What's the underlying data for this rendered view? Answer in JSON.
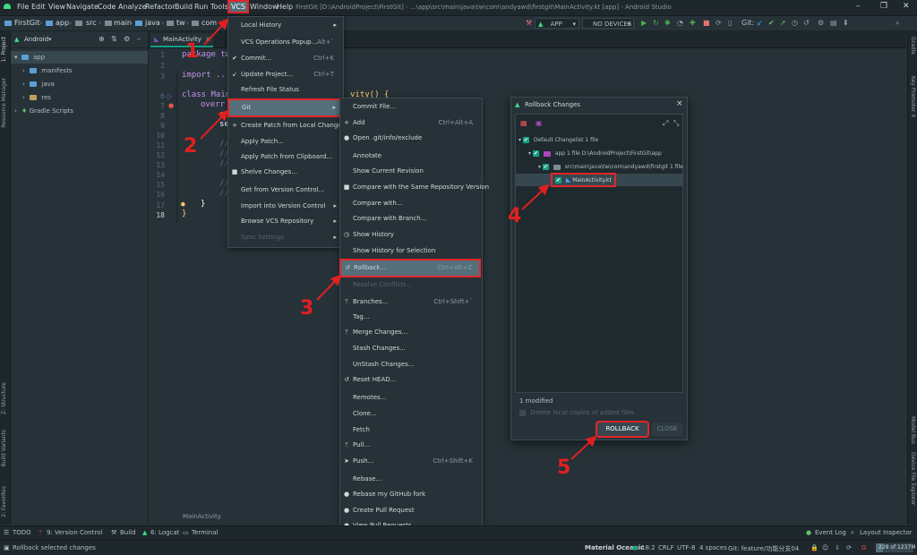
{
  "window_title": "FirstGit [D:\\AndroidProject\\FirstGit] - ...\\app\\src\\main\\java\\tw\\com\\andyawd\\firstgit\\MainActivity.kt [app] - Android Studio",
  "menubar": [
    "File",
    "Edit",
    "View",
    "Navigate",
    "Code",
    "Analyze",
    "Refactor",
    "Build",
    "Run",
    "Tools",
    "VCS",
    "Window",
    "Help"
  ],
  "breadcrumbs": [
    "FirstGit",
    "app",
    "src",
    "main",
    "java",
    "tw",
    "com"
  ],
  "run_config": "APP",
  "device": "NO DEVICES",
  "git_label": "Git:",
  "project_panel": {
    "view": "Android",
    "tree": [
      {
        "label": "app",
        "level": 0,
        "selected": true
      },
      {
        "label": "manifests",
        "level": 1
      },
      {
        "label": "java",
        "level": 1
      },
      {
        "label": "res",
        "level": 1
      },
      {
        "label": "Gradle Scripts",
        "level": 0
      }
    ]
  },
  "editor": {
    "tab": "MainActivity",
    "tab_close": "×",
    "line_numbers": [
      "1",
      "2",
      "3",
      "",
      "6",
      "7",
      "8",
      "9",
      "10",
      "11",
      "12",
      "13",
      "14",
      "15",
      "16",
      "17",
      "18"
    ],
    "code": {
      "l1": "package tw",
      "l3": "import ...",
      "l6": "class Main",
      "l6b": "vity() {",
      "l7": "overr",
      "l8": "s",
      "l9": "se",
      "l11": "//",
      "l12": "//",
      "l13": "//",
      "l15": "//",
      "l16": "//",
      "l17": "}",
      "l18": "}"
    },
    "breadcrumb_bottom": "MainActivity"
  },
  "vcs_menu": [
    {
      "label": "Local History",
      "arrow": true
    },
    {
      "label": "VCS Operations Popup...",
      "shortcut": "Alt+`"
    },
    {
      "label": "Commit...",
      "shortcut": "Ctrl+K",
      "icon": "✔"
    },
    {
      "label": "Update Project...",
      "shortcut": "Ctrl+T",
      "icon": "↙"
    },
    {
      "label": "Refresh File Status"
    },
    {
      "label": "Git",
      "arrow": true,
      "selected": true
    },
    {
      "label": "Create Patch from Local Changes...",
      "icon": "+"
    },
    {
      "label": "Apply Patch..."
    },
    {
      "label": "Apply Patch from Clipboard..."
    },
    {
      "label": "Shelve Changes...",
      "icon": "■"
    },
    {
      "label": "Get from Version Control..."
    },
    {
      "label": "Import into Version Control",
      "arrow": true
    },
    {
      "label": "Browse VCS Repository",
      "arrow": true
    },
    {
      "label": "Sync Settings",
      "arrow": true,
      "disabled": true
    }
  ],
  "git_menu": [
    {
      "label": "Commit File..."
    },
    {
      "label": "Add",
      "shortcut": "Ctrl+Alt+A",
      "icon": "+"
    },
    {
      "label": "Open .git/info/exclude",
      "icon": "●"
    },
    {
      "label": "Annotate"
    },
    {
      "label": "Show Current Revision"
    },
    {
      "label": "Compare with the Same Repository Version",
      "icon": "■"
    },
    {
      "label": "Compare with..."
    },
    {
      "label": "Compare with Branch..."
    },
    {
      "label": "Show History",
      "icon": "◷"
    },
    {
      "label": "Show History for Selection"
    },
    {
      "label": "Rollback...",
      "shortcut": "Ctrl+Alt+Z",
      "icon": "↺",
      "selected": true
    },
    {
      "label": "Resolve Conflicts...",
      "disabled": true
    },
    {
      "label": "Branches...",
      "shortcut": "Ctrl+Shift+`",
      "icon": "ᛘ"
    },
    {
      "label": "Tag..."
    },
    {
      "label": "Merge Changes...",
      "icon": "ᛘ"
    },
    {
      "label": "Stash Changes..."
    },
    {
      "label": "UnStash Changes..."
    },
    {
      "label": "Reset HEAD...",
      "icon": "↺"
    },
    {
      "label": "Remotes..."
    },
    {
      "label": "Clone..."
    },
    {
      "label": "Fetch"
    },
    {
      "label": "Pull...",
      "icon": "ᛘ"
    },
    {
      "label": "Push...",
      "shortcut": "Ctrl+Shift+K",
      "icon": "➤"
    },
    {
      "label": "Rebase..."
    },
    {
      "label": "Rebase my GitHub fork",
      "icon": "●"
    },
    {
      "label": "Create Pull Request",
      "icon": "●"
    },
    {
      "label": "View Pull Requests",
      "icon": "●"
    }
  ],
  "rollback_dialog": {
    "title": "Rollback Changes",
    "close": "×",
    "tree": [
      {
        "label": "Default Changelist 1 file",
        "level": 0
      },
      {
        "label": "app 1 file D:\\AndroidProject\\FirstGit\\app",
        "level": 1
      },
      {
        "label": "src\\main\\java\\tw\\com\\andyawd\\firstgit 1 file",
        "level": 2
      },
      {
        "label": "MainActivity.kt",
        "level": 3
      }
    ],
    "summary": "1 modified",
    "delete_checkbox": "Delete local copies of added files",
    "rollback_button": "ROLLBACK",
    "close_button": "CLOSE"
  },
  "annotations": [
    "1",
    "2",
    "3",
    "4",
    "5"
  ],
  "left_tabs": [
    "1: Project",
    "Resource Manager",
    "Z: Structure",
    "Build Variants",
    "2: Favorites"
  ],
  "right_tabs": [
    "Gradle",
    "Key Promoter X",
    "Model Bus",
    "Device File Explorer"
  ],
  "tool_windows": [
    "TODO",
    "9: Version Control",
    "Build",
    "6: Logcat",
    "Terminal"
  ],
  "event_log": "Event Log",
  "layout_inspector": "Layout Inspector",
  "status": {
    "message": "Rollback selected changes",
    "theme": "Material Oceanic",
    "position": "18:2",
    "line_sep": "CRLF",
    "encoding": "UTF-8",
    "indent": "4 spaces",
    "branch": "Git: feature/功能分支04",
    "memory": "228 of 1237M"
  },
  "colors": {
    "highlight": "#e5252a",
    "accent": "#16a085",
    "selected": "#546e7a"
  }
}
